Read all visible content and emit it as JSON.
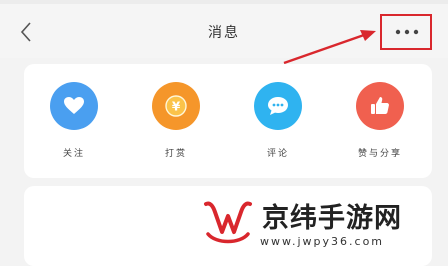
{
  "header": {
    "title": "消息",
    "back_icon": "chevron-left-icon",
    "more_icon": "more-horizontal-icon",
    "annotation_color": "#d9272d"
  },
  "actions": [
    {
      "label": "关注",
      "icon": "heart-icon",
      "color": "#4a9ff0"
    },
    {
      "label": "打赏",
      "icon": "yen-coin-icon",
      "color": "#f5962a"
    },
    {
      "label": "评论",
      "icon": "chat-bubble-icon",
      "color": "#2fb3f0"
    },
    {
      "label": "赞与分享",
      "icon": "thumbs-up-icon",
      "color": "#f0604f"
    }
  ],
  "watermark": {
    "text": "京纬手游网",
    "url": "www.jwpy36.com"
  }
}
